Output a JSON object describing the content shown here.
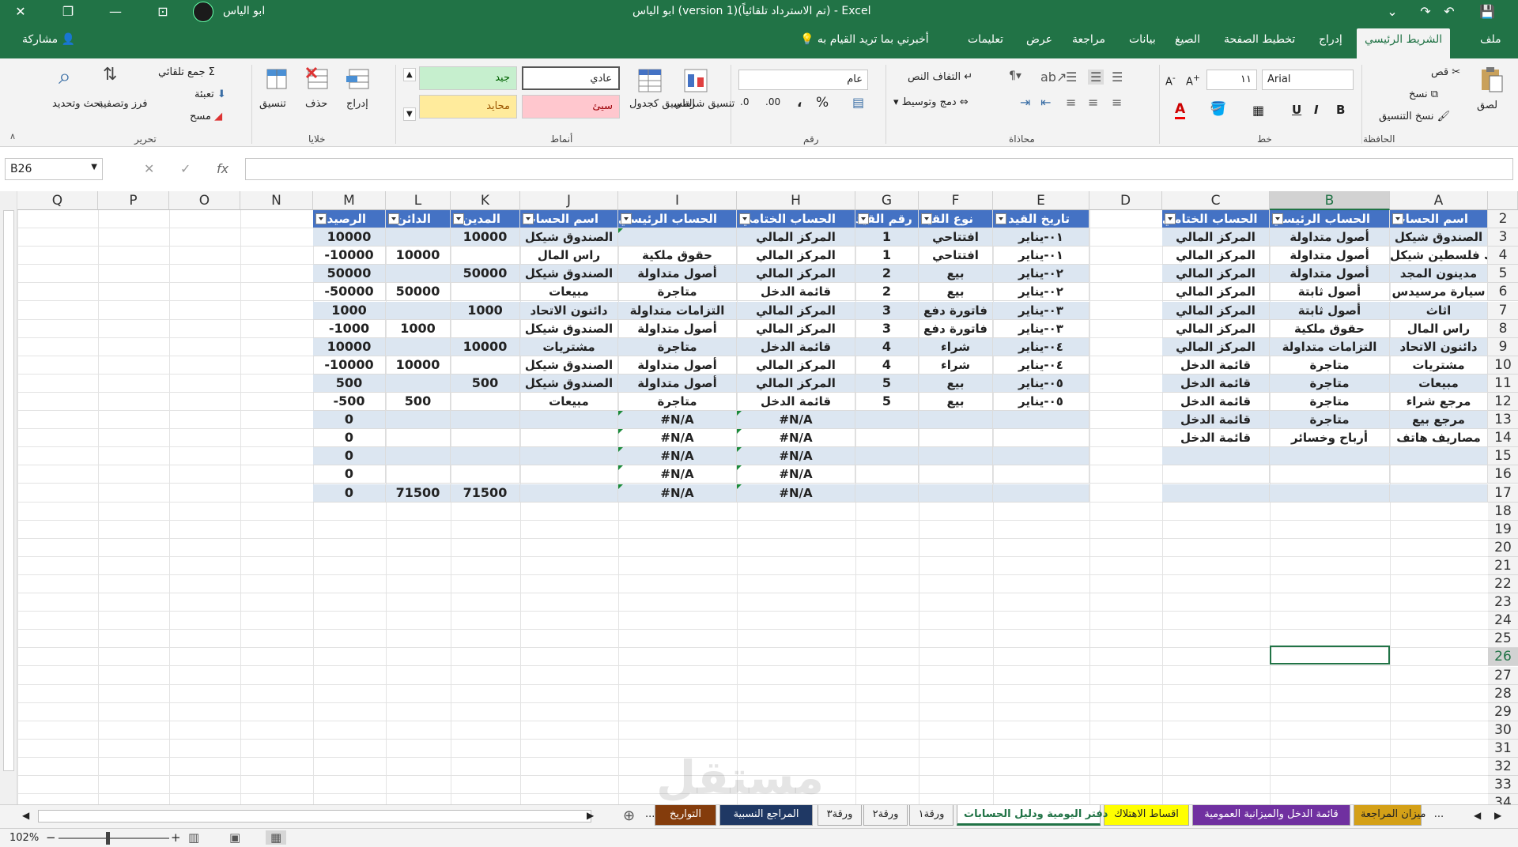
{
  "titlebar": {
    "title": "ابو الياس (version 1)(تم الاسترداد تلقائياً)  -  Excel",
    "user": "ابو الياس",
    "close": "✕",
    "restore": "❐",
    "minimize": "—",
    "ribbon_opts": "⊡",
    "save": "💾",
    "undo": "↶",
    "redo": "↷",
    "more": "⌄"
  },
  "tabs": [
    "ملف",
    "الشريط الرئيسي",
    "إدراج",
    "تخطيط الصفحة",
    "الصيغ",
    "بيانات",
    "مراجعة",
    "عرض",
    "تعليمات"
  ],
  "active_tab": "الشريط الرئيسي",
  "tellme": "أخبرني بما تريد القيام به",
  "share": "مشاركة",
  "ribbon": {
    "clipboard": {
      "label": "الحافظة",
      "paste": "لصق",
      "cut": "قص",
      "copy": "نسخ",
      "format_painter": "نسخ التنسيق"
    },
    "font": {
      "label": "خط",
      "name": "Arial",
      "size": "١١",
      "bold": "B",
      "italic": "I",
      "underline": "U"
    },
    "alignment": {
      "label": "محاذاة",
      "wrap": "التفاف النص",
      "merge": "دمج وتوسيط"
    },
    "number": {
      "label": "رقم",
      "format": "عام",
      "percent": "%",
      "comma": "،"
    },
    "styles": {
      "label": "أنماط",
      "cond_format": "تنسيق شرطي",
      "as_table": "التنسيق كجدول",
      "normal": "عادي",
      "good": "جيد",
      "bad": "سيئ",
      "neutral": "محايد"
    },
    "cells": {
      "label": "خلايا",
      "insert": "إدراج",
      "delete": "حذف",
      "format": "تنسيق"
    },
    "editing": {
      "label": "تحرير",
      "autosum": "جمع تلقائي",
      "fill": "تعبئة",
      "clear": "مسح",
      "sort": "فرز وتصفية",
      "find": "بحث وتحديد"
    }
  },
  "formula_bar": {
    "name_box": "B26",
    "cancel": "✕",
    "enter": "✓",
    "fx": "fx",
    "value": ""
  },
  "columns": [
    "A",
    "B",
    "C",
    "D",
    "E",
    "F",
    "G",
    "H",
    "I",
    "J",
    "K",
    "L",
    "M",
    "N",
    "O",
    "P",
    "Q"
  ],
  "rows": [
    "2",
    "3",
    "4",
    "5",
    "6",
    "7",
    "8",
    "9",
    "10",
    "11",
    "12",
    "13",
    "14",
    "15",
    "16",
    "17",
    "18",
    "19",
    "20",
    "21",
    "22",
    "23",
    "24",
    "25",
    "26",
    "27",
    "28",
    "29",
    "30",
    "31",
    "32",
    "33",
    "34"
  ],
  "accounts_table": {
    "headers": [
      "اسم الحساب",
      "الحساب الرئيسي",
      "الحساب الختامي"
    ],
    "rows": [
      [
        "الصندوق شيكل",
        "أصول متداولة",
        "المركز المالي"
      ],
      [
        "بنك فلسطين شيكل",
        "أصول متداولة",
        "المركز المالي"
      ],
      [
        "مدينون المجد",
        "أصول متداولة",
        "المركز المالي"
      ],
      [
        "سيارة مرسيدس",
        "أصول ثابتة",
        "المركز المالي"
      ],
      [
        "اثاث",
        "أصول ثابتة",
        "المركز المالي"
      ],
      [
        "راس المال",
        "حقوق ملكية",
        "المركز المالي"
      ],
      [
        "دائنون الاتحاد",
        "التزامات  متداولة",
        "المركز المالي"
      ],
      [
        "مشتريات",
        "متاجرة",
        "قائمة الدخل"
      ],
      [
        "مبيعات",
        "متاجرة",
        "قائمة الدخل"
      ],
      [
        "مرجع شراء",
        "متاجرة",
        "قائمة الدخل"
      ],
      [
        "مرجع بيع",
        "متاجرة",
        "قائمة الدخل"
      ],
      [
        "مصاريف هاتف",
        "أرباح وخسائر",
        "قائمة الدخل"
      ],
      [
        "",
        "",
        ""
      ],
      [
        "",
        "",
        ""
      ],
      [
        "",
        "",
        ""
      ]
    ]
  },
  "journal_table": {
    "headers": [
      "تاريخ القيد",
      "نوع القيد",
      "رقم القيد",
      "الحساب الختامي",
      "الحساب الرئيسي",
      "اسم الحساب",
      "المدين",
      "الدائن",
      "الرصيد"
    ],
    "rows": [
      [
        "٠١-يناير",
        "افتتاحي",
        "1",
        "المركز المالي",
        "",
        "الصندوق شيكل",
        "10000",
        "",
        "10000"
      ],
      [
        "٠١-يناير",
        "افتتاحي",
        "1",
        "المركز المالي",
        "حقوق ملكية",
        "راس المال",
        "",
        "10000",
        "-10000"
      ],
      [
        "٠٢-يناير",
        "بيع",
        "2",
        "المركز المالي",
        "أصول متداولة",
        "الصندوق شيكل",
        "50000",
        "",
        "50000"
      ],
      [
        "٠٢-يناير",
        "بيع",
        "2",
        "قائمة الدخل",
        "متاجرة",
        "مبيعات",
        "",
        "50000",
        "-50000"
      ],
      [
        "٠٣-يناير",
        "فاتورة دفع",
        "3",
        "المركز المالي",
        "التزامات  متداولة",
        "دائنون الاتحاد",
        "1000",
        "",
        "1000"
      ],
      [
        "٠٣-يناير",
        "فاتورة دفع",
        "3",
        "المركز المالي",
        "أصول متداولة",
        "الصندوق شيكل",
        "",
        "1000",
        "-1000"
      ],
      [
        "٠٤-يناير",
        "شراء",
        "4",
        "قائمة الدخل",
        "متاجرة",
        "مشتريات",
        "10000",
        "",
        "10000"
      ],
      [
        "٠٤-يناير",
        "شراء",
        "4",
        "المركز المالي",
        "أصول متداولة",
        "الصندوق شيكل",
        "",
        "10000",
        "-10000"
      ],
      [
        "٠٥-يناير",
        "بيع",
        "5",
        "المركز المالي",
        "أصول متداولة",
        "الصندوق شيكل",
        "500",
        "",
        "500"
      ],
      [
        "٠٥-يناير",
        "بيع",
        "5",
        "قائمة الدخل",
        "متاجرة",
        "مبيعات",
        "",
        "500",
        "-500"
      ],
      [
        "",
        "",
        "",
        "#N/A",
        "#N/A",
        "",
        "",
        "",
        "0"
      ],
      [
        "",
        "",
        "",
        "#N/A",
        "#N/A",
        "",
        "",
        "",
        "0"
      ],
      [
        "",
        "",
        "",
        "#N/A",
        "#N/A",
        "",
        "",
        "",
        "0"
      ],
      [
        "",
        "",
        "",
        "#N/A",
        "#N/A",
        "",
        "",
        "",
        "0"
      ],
      [
        "",
        "",
        "",
        "#N/A",
        "#N/A",
        "",
        "71500",
        "71500",
        "0"
      ]
    ]
  },
  "sheet_tabs": [
    {
      "name": "...",
      "color": "#f3f3f3",
      "fg": "#222"
    },
    {
      "name": "ميزان المراجعة",
      "color": "#d4a017",
      "fg": "#222"
    },
    {
      "name": "قائمة الدخل والميزانية العمومية",
      "color": "#7030a0",
      "fg": "#fff"
    },
    {
      "name": "اقساط الاهتلاك",
      "color": "#ffff00",
      "fg": "#222"
    },
    {
      "name": "دفتر اليومية ودليل الحسابات",
      "color": "#ffffff",
      "fg": "#217346"
    },
    {
      "name": "ورقة١",
      "color": "#f3f3f3",
      "fg": "#222"
    },
    {
      "name": "ورقة٢",
      "color": "#f3f3f3",
      "fg": "#222"
    },
    {
      "name": "ورقة٣",
      "color": "#f3f3f3",
      "fg": "#222"
    },
    {
      "name": "المراجع النسبية",
      "color": "#1f3864",
      "fg": "#fff"
    },
    {
      "name": "التواريخ",
      "color": "#843c0c",
      "fg": "#fff"
    },
    {
      "name": "...",
      "color": "#f3f3f3",
      "fg": "#222"
    }
  ],
  "status": {
    "zoom": "102%",
    "minus": "−",
    "plus": "+"
  },
  "watermark": "مستقل"
}
